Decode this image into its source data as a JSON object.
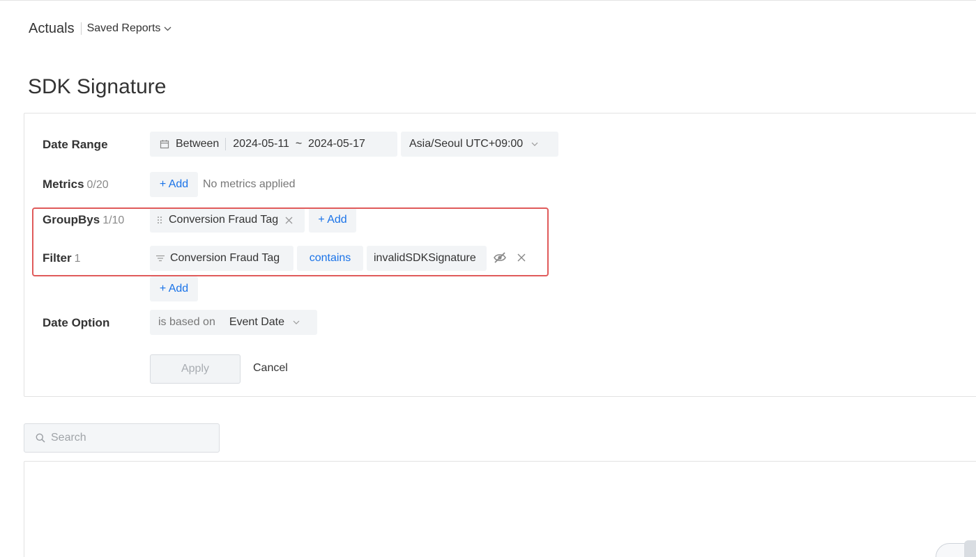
{
  "header": {
    "app_title": "Actuals",
    "saved_reports_label": "Saved Reports"
  },
  "page_title": "SDK Signature",
  "filters": {
    "date_range": {
      "label": "Date Range",
      "mode": "Between",
      "range": "2024-05-11  ~  2024-05-17",
      "timezone": "Asia/Seoul UTC+09:00"
    },
    "metrics": {
      "label": "Metrics",
      "count": "0/20",
      "add_label": "+ Add",
      "empty_text": "No metrics applied"
    },
    "groupbys": {
      "label": "GroupBys",
      "count": "1/10",
      "items": [
        "Conversion Fraud Tag"
      ],
      "add_label": "+ Add"
    },
    "filter": {
      "label": "Filter",
      "count": "1",
      "field": "Conversion Fraud Tag",
      "operator": "contains",
      "value": "invalidSDKSignature",
      "add_label": "+ Add"
    },
    "date_option": {
      "label": "Date Option",
      "prefix": "is based on",
      "value": "Event Date"
    }
  },
  "actions": {
    "apply_label": "Apply",
    "cancel_label": "Cancel"
  },
  "search": {
    "placeholder": "Search",
    "value": ""
  },
  "colors": {
    "accent": "#1a73e8",
    "highlight": "#e05a5a",
    "chip_bg": "#f2f4f6"
  }
}
